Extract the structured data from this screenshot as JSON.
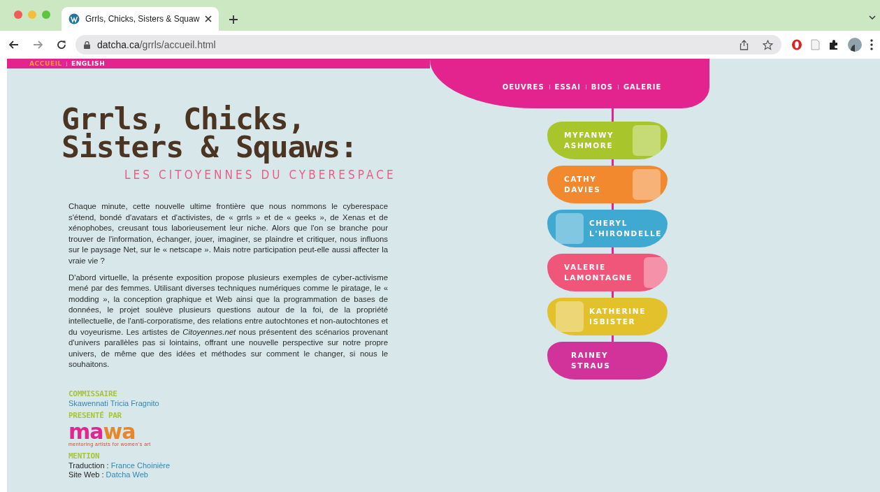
{
  "browser": {
    "tab": {
      "title": "Grrls, Chicks, Sisters & Squaw",
      "selected": true
    },
    "address": {
      "host": "datcha.ca",
      "path": "/grrls/accueil.html"
    }
  },
  "language_bar": [
    {
      "label": "ACCUEIL",
      "selected": true
    },
    {
      "label": "ENGLISH",
      "selected": false
    }
  ],
  "nav": [
    "OEUVRES",
    "ESSAI",
    "BIOS",
    "GALERIE"
  ],
  "title": {
    "line_1": "Grrls, Chicks,",
    "line_2": "Sisters & Squaws:",
    "subtitle": "LES CITOYENNES DU CYBERESPACE"
  },
  "paragraphs": [
    "Chaque minute, cette nouvelle ultime frontière que nous nommons le cyberespace s'étend, bondé d'avatars et d'activistes, de « grrls » et de « geeks », de Xenas et de xénophobes, creusant tous laborieusement leur niche. Alors que l'on se branche pour trouver de l'information, échanger, jouer, imaginer, se plaindre et critiquer, nous influons sur le paysage Net, sur le « netscape ». Mais notre participation peut-elle aussi affecter la vraie vie ?",
    "D'abord virtuelle, la présente exposition propose plusieurs exemples de cyber-activisme mené par des femmes. Utilisant diverses techniques numériques comme le piratage, le « modding », la conception graphique et Web ainsi que la programmation de bases de données, le projet soulève plusieurs questions autour de la foi, de la propriété intellectuelle, de l'anti-corporatisme, des relations entre autochtones et non-autochtones et du voyeurisme. Les artistes de *Citoyennes.net* nous présentent des scénarios provenant d'univers parallèles pas si lointains, offrant une nouvelle perspective sur notre propre univers, de même que des idées et méthodes sur comment le changer, si nous le souhaitons."
  ],
  "credits": {
    "curator_label": "COMMISSAIRE",
    "curator": "Skawennati Tricia Fragnito",
    "presented_label": "PRESENTÉ PAR",
    "logo": {
      "parts": [
        {
          "text": "ma",
          "color": "#e0268f"
        },
        {
          "text": "wa",
          "color": "#e8862a"
        }
      ],
      "tagline": "mentoring artists for women's art"
    },
    "mention_label": "MENTION",
    "mentions": [
      {
        "label": "Traduction : ",
        "link": "France Choinière"
      },
      {
        "label": "Site Web : ",
        "link": "Datcha Web"
      }
    ]
  },
  "artists": [
    {
      "line_1": "MYFANWY",
      "line_2": "ASHMORE",
      "color": "#a8c62c",
      "kind": "photo_right"
    },
    {
      "line_1": "CATHY",
      "line_2": "DAVIES",
      "color": "#f2892e",
      "kind": "photo_right"
    },
    {
      "line_1": "CHERYL",
      "line_2": "L'HIRONDELLE",
      "color": "#3fa9d2",
      "kind": "photo_left"
    },
    {
      "line_1": "VALERIE",
      "line_2": "LAMONTAGNE",
      "color": "#f0567a",
      "kind": "photo_right"
    },
    {
      "line_1": "KATHERINE",
      "line_2": "ISBISTER",
      "color": "#e3c12b",
      "kind": "photo_left"
    },
    {
      "line_1": "RAINEY",
      "line_2": "STRAUS",
      "color": "#d1339b",
      "kind": "text_only"
    }
  ]
}
